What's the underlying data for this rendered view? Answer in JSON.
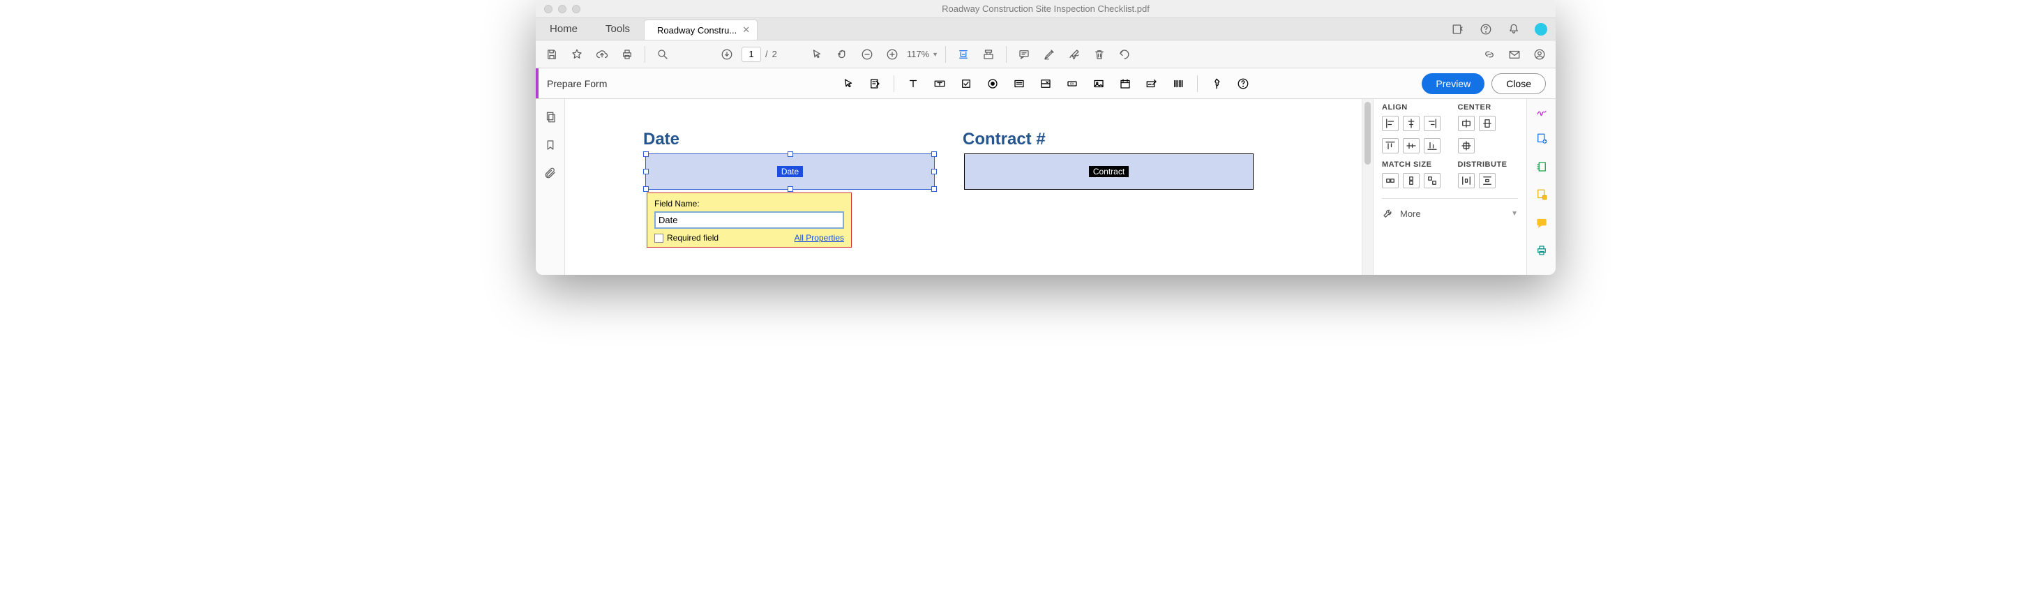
{
  "window": {
    "title": "Roadway Construction Site Inspection Checklist.pdf"
  },
  "tabs": {
    "home": "Home",
    "tools": "Tools",
    "doc": "Roadway Constru..."
  },
  "toolbar": {
    "page_current": "1",
    "page_sep": "/",
    "page_total": "2",
    "zoom": "117%"
  },
  "formbar": {
    "title": "Prepare Form",
    "preview": "Preview",
    "close": "Close"
  },
  "fields": {
    "date_label": "Date",
    "date_tag": "Date",
    "contract_label": "Contract #",
    "contract_tag": "Contract"
  },
  "popup": {
    "fieldname_label": "Field Name:",
    "fieldname_value": "Date",
    "required_label": "Required field",
    "all_props": "All Properties"
  },
  "sidepanel": {
    "align": "ALIGN",
    "center": "CENTER",
    "match": "MATCH SIZE",
    "distribute": "DISTRIBUTE",
    "more": "More"
  }
}
